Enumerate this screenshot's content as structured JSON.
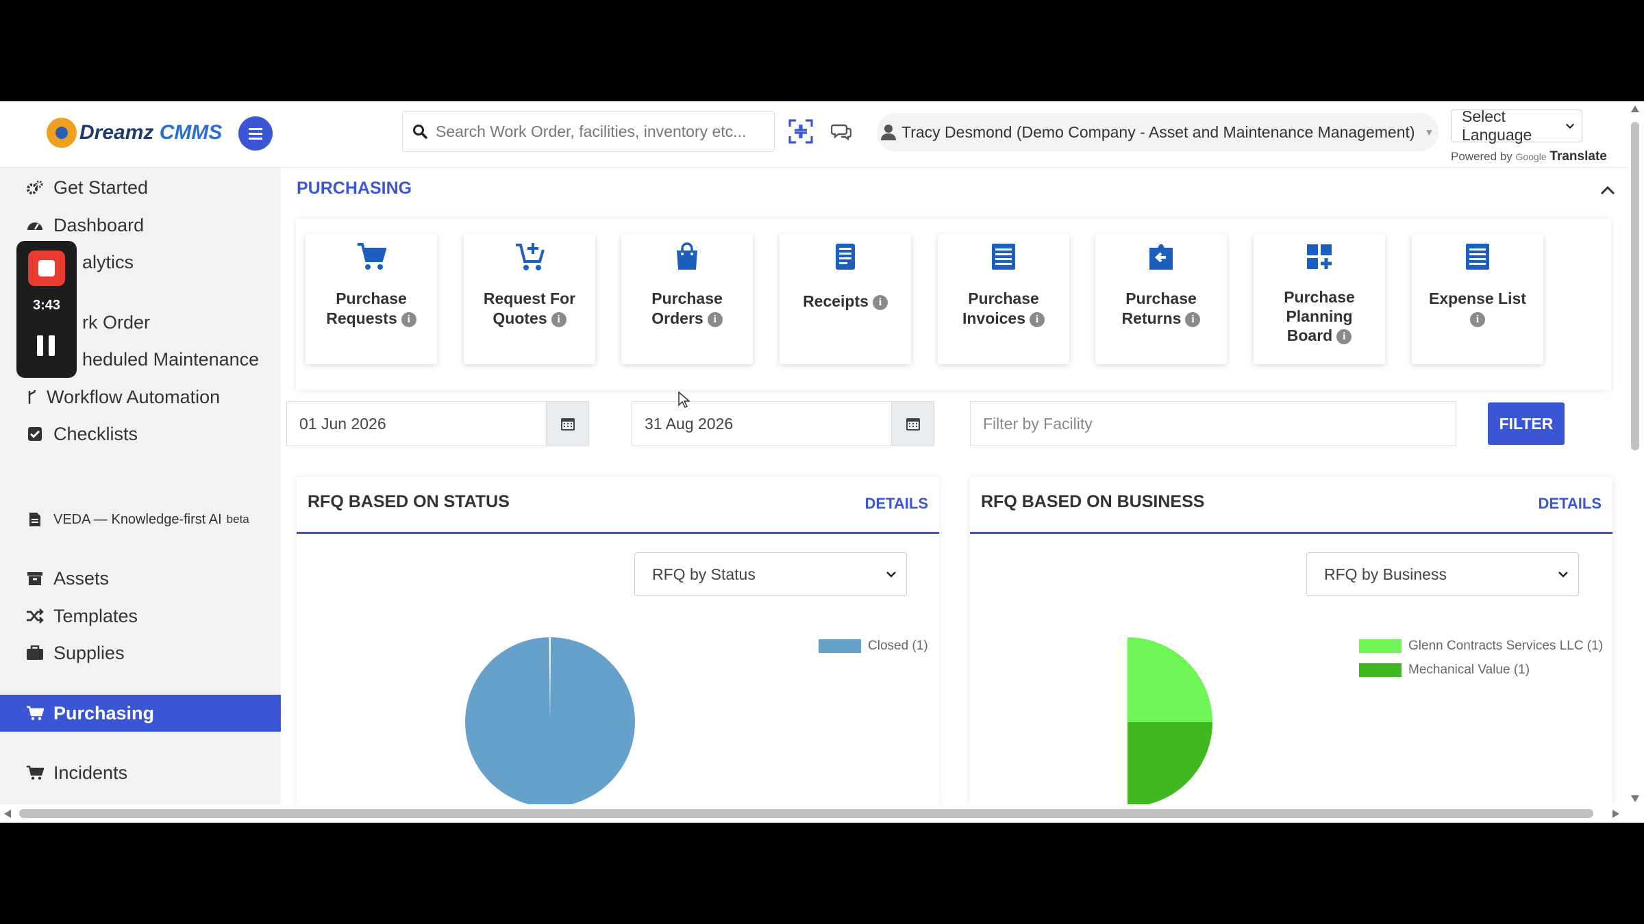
{
  "header": {
    "logo_text_1": "Dreamz",
    "logo_text_2": "CMMS",
    "search_placeholder": "Search Work Order, facilities, inventory etc...",
    "user_label": "Tracy Desmond (Demo Company - Asset and Maintenance Management)",
    "language_select": "Select Language",
    "powered_by": "Powered by",
    "google": "Google",
    "translate": "Translate"
  },
  "recorder": {
    "time": "3:43"
  },
  "sidebar": {
    "items": [
      {
        "label": "Get Started",
        "icon": "cogs-icon"
      },
      {
        "label": "Dashboard",
        "icon": "dashboard-icon"
      },
      {
        "label": "alytics",
        "icon": "analytics-icon"
      },
      {
        "label": "rk Order",
        "icon": "work-order-icon"
      },
      {
        "label": "heduled Maintenance",
        "icon": "calendar-icon"
      },
      {
        "label": "Workflow Automation",
        "icon": "workflow-icon"
      },
      {
        "label": "Checklists",
        "icon": "checkbox-icon"
      },
      {
        "label": "VEDA — Knowledge-first AI",
        "badge": "beta",
        "icon": "document-icon"
      },
      {
        "label": "Assets",
        "icon": "archive-icon"
      },
      {
        "label": "Templates",
        "icon": "shuffle-icon"
      },
      {
        "label": "Supplies",
        "icon": "briefcase-icon"
      },
      {
        "label": "Purchasing",
        "icon": "cart-icon"
      },
      {
        "label": "Incidents",
        "icon": "cart-icon"
      }
    ]
  },
  "main": {
    "section_title": "PURCHASING",
    "tiles": [
      {
        "line1": "Purchase",
        "line2": "Requests",
        "icon": "cart-icon"
      },
      {
        "line1": "Request For",
        "line2": "Quotes",
        "icon": "cart-plus-icon"
      },
      {
        "line1": "Purchase",
        "line2": "Orders",
        "icon": "shopping-bag-icon"
      },
      {
        "line1": "Receipts",
        "line2": "",
        "icon": "receipt-icon"
      },
      {
        "line1": "Purchase",
        "line2": "Invoices",
        "icon": "list-icon"
      },
      {
        "line1": "Purchase",
        "line2": "Returns",
        "icon": "return-icon"
      },
      {
        "line1": "Purchase",
        "line2": "Planning",
        "line3": "Board",
        "icon": "grid-plus-icon"
      },
      {
        "line1": "Expense List",
        "line2": "",
        "icon": "list-icon"
      }
    ],
    "filters": {
      "start_date": "01 Jun 2026",
      "end_date": "31 Aug 2026",
      "facility_placeholder": "Filter by Facility",
      "filter_button": "FILTER"
    },
    "cards": [
      {
        "title": "RFQ BASED ON STATUS",
        "details": "DETAILS",
        "select": "RFQ by Status",
        "legend": [
          {
            "label": "Closed (1)",
            "color": "#65a1cb"
          }
        ]
      },
      {
        "title": "RFQ BASED ON BUSINESS",
        "details": "DETAILS",
        "select": "RFQ by Business",
        "legend": [
          {
            "label": "Glenn Contracts Services LLC (1)",
            "color": "#6ef455"
          },
          {
            "label": "Mechanical Value (1)",
            "color": "#3fb91f"
          }
        ]
      }
    ]
  },
  "chart_data": [
    {
      "type": "pie",
      "title": "RFQ BASED ON STATUS",
      "categories": [
        "Closed"
      ],
      "values": [
        1
      ]
    },
    {
      "type": "pie",
      "title": "RFQ BASED ON BUSINESS",
      "categories": [
        "Glenn Contracts Services LLC",
        "Mechanical Value"
      ],
      "values": [
        1,
        1
      ]
    }
  ]
}
